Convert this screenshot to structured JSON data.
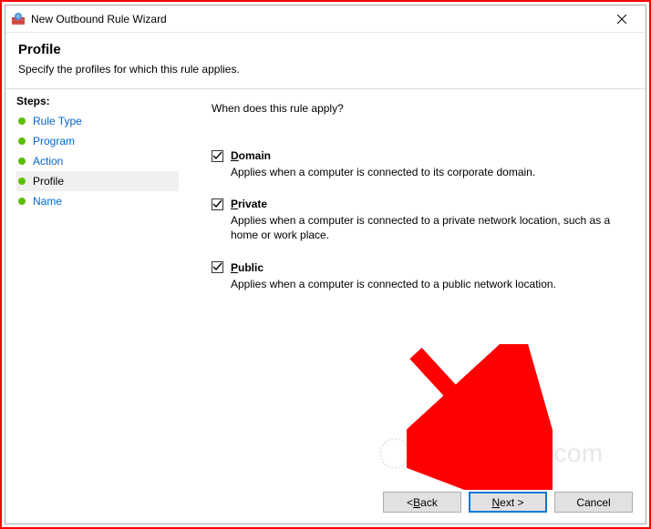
{
  "window": {
    "title": "New Outbound Rule Wizard"
  },
  "header": {
    "title": "Profile",
    "subtitle": "Specify the profiles for which this rule applies."
  },
  "sidebar": {
    "heading": "Steps:",
    "items": [
      {
        "label": "Rule Type",
        "current": false,
        "bullet": "#5bbf00"
      },
      {
        "label": "Program",
        "current": false,
        "bullet": "#5bbf00"
      },
      {
        "label": "Action",
        "current": false,
        "bullet": "#5bbf00"
      },
      {
        "label": "Profile",
        "current": true,
        "bullet": "#5bbf00"
      },
      {
        "label": "Name",
        "current": false,
        "bullet": "#5bbf00"
      }
    ]
  },
  "main": {
    "question": "When does this rule apply?",
    "options": [
      {
        "checked": true,
        "label_prefix": "D",
        "label_rest": "omain",
        "desc": "Applies when a computer is connected to its corporate domain."
      },
      {
        "checked": true,
        "label_prefix": "P",
        "label_rest": "rivate",
        "desc": "Applies when a computer is connected to a private network location, such as a home or work place."
      },
      {
        "checked": true,
        "label_prefix": "P",
        "label_rest": "ublic",
        "desc": "Applies when a computer is connected to a public network location."
      }
    ]
  },
  "buttons": {
    "back_prefix": "< ",
    "back_u": "B",
    "back_rest": "ack",
    "next_u": "N",
    "next_rest": "ext >",
    "cancel": "Cancel"
  },
  "watermark": {
    "text": "uantrimang.com"
  }
}
